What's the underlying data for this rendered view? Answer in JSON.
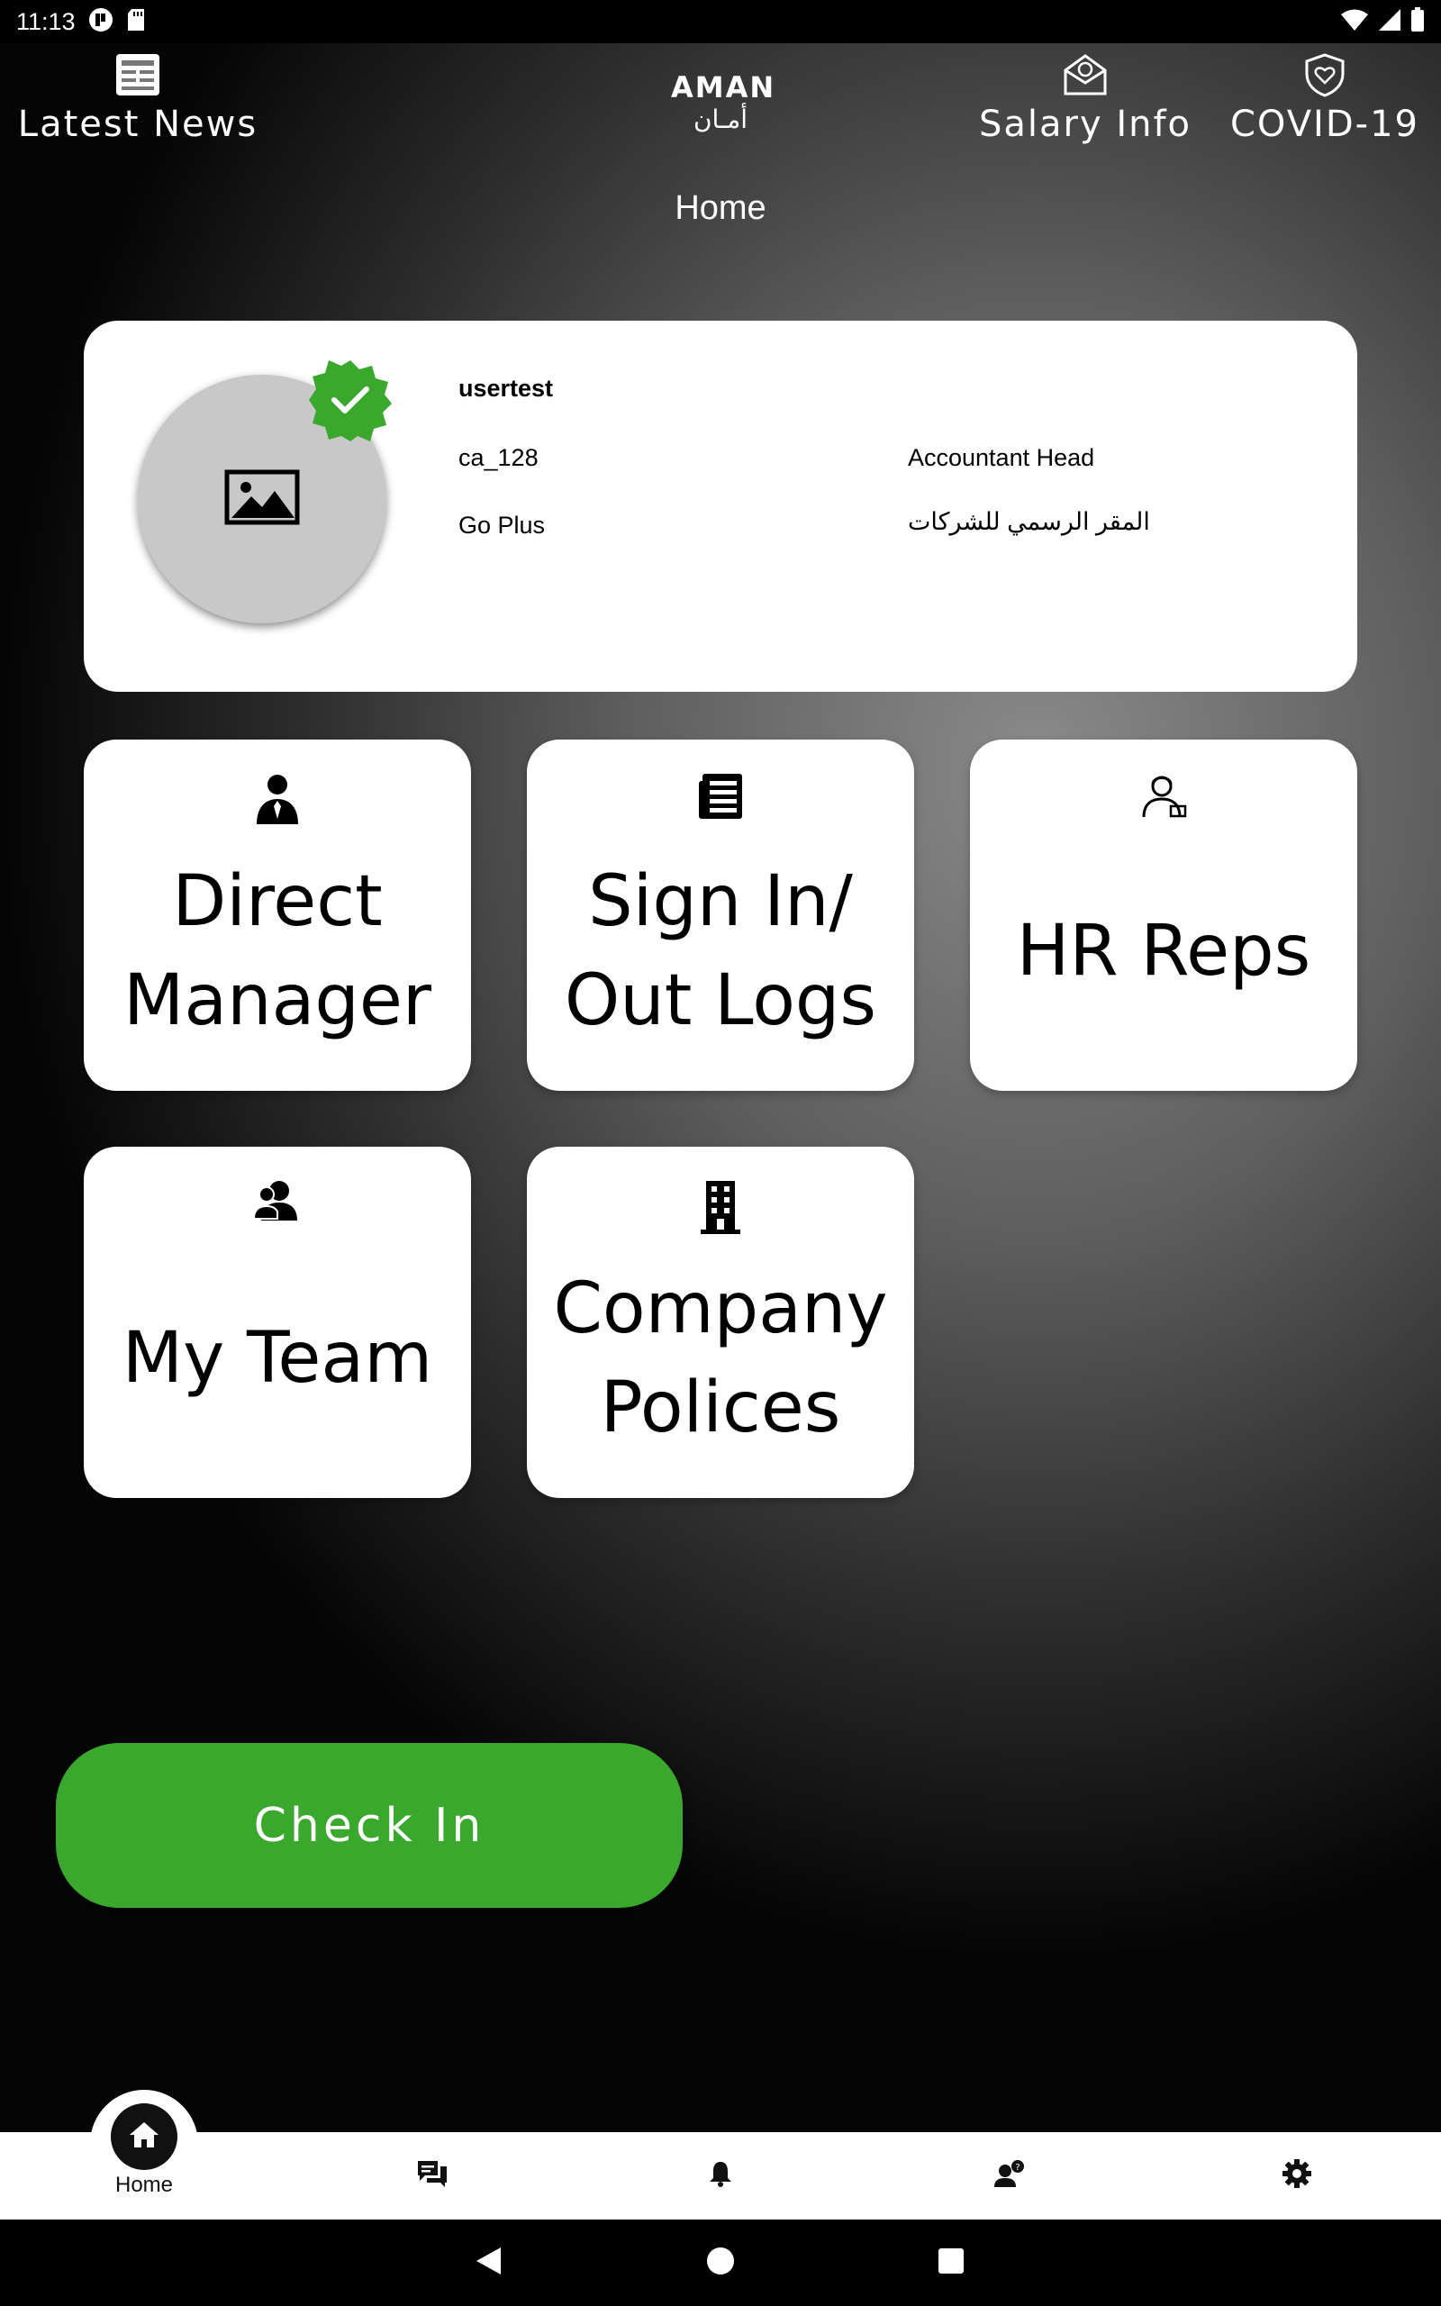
{
  "status_bar": {
    "time": "11:13",
    "left_icons": [
      "circle-p-icon",
      "sd-card-icon"
    ],
    "right_icons": [
      "wifi-icon",
      "cell-signal-icon",
      "battery-icon"
    ]
  },
  "header": {
    "left": {
      "label": "Latest News",
      "icon": "newspaper-icon"
    },
    "logo": {
      "line1": "AMAN",
      "line2": "أمـان"
    },
    "right": [
      {
        "label": "Salary Info",
        "icon": "envelope-money-icon"
      },
      {
        "label": "COVID-19",
        "icon": "shield-heart-icon"
      }
    ],
    "page_title": "Home"
  },
  "profile": {
    "name": "usertest",
    "code": "ca_128",
    "position": "Accountant Head",
    "company": "Go Plus",
    "branch": "المقر الرسمي للشركات",
    "verified_icon": "verified-badge-icon",
    "avatar_icon": "image-placeholder-icon"
  },
  "tiles": [
    {
      "label_line1": "Direct",
      "label_line2": "Manager",
      "icon": "person-tie-icon"
    },
    {
      "label_line1": "Sign In/",
      "label_line2": "Out Logs",
      "icon": "document-list-icon"
    },
    {
      "label_line1": "HR Reps",
      "label_line2": "",
      "icon": "hr-rep-icon"
    },
    {
      "label_line1": "My Team",
      "label_line2": "",
      "icon": "team-icon"
    },
    {
      "label_line1": "Company",
      "label_line2": "Polices",
      "icon": "building-icon"
    }
  ],
  "check_in": {
    "label": "Check In",
    "color": "#3aa82c"
  },
  "bottom_nav": {
    "items": [
      {
        "label": "Home",
        "icon": "home-icon",
        "active": true
      },
      {
        "label": "",
        "icon": "chat-icon"
      },
      {
        "label": "",
        "icon": "bell-icon"
      },
      {
        "label": "",
        "icon": "person-question-icon"
      },
      {
        "label": "",
        "icon": "gear-icon"
      }
    ]
  },
  "system_nav": [
    "back-icon",
    "home-circle-icon",
    "recents-icon"
  ]
}
